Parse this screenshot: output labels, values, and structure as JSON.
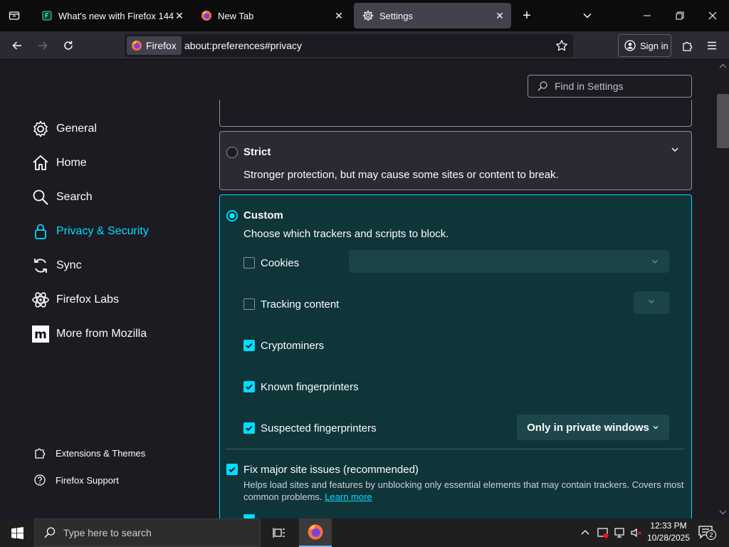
{
  "tabs": [
    {
      "title": "What's new with Firefox 144",
      "icon": "firefox-whatsnew-icon"
    },
    {
      "title": "New Tab",
      "icon": "firefox-logo-icon"
    },
    {
      "title": "Settings",
      "icon": "gear-icon",
      "active": true
    }
  ],
  "navbar": {
    "identity_label": "Firefox",
    "url": "about:preferences#privacy",
    "signin_label": "Sign in"
  },
  "search": {
    "placeholder": "Find in Settings"
  },
  "sidebar": {
    "items": [
      {
        "label": "General",
        "icon": "gear-icon"
      },
      {
        "label": "Home",
        "icon": "home-icon"
      },
      {
        "label": "Search",
        "icon": "search-icon"
      },
      {
        "label": "Privacy & Security",
        "icon": "lock-icon",
        "selected": true
      },
      {
        "label": "Sync",
        "icon": "sync-icon"
      },
      {
        "label": "Firefox Labs",
        "icon": "labs-icon"
      },
      {
        "label": "More from Mozilla",
        "icon": "mozilla-icon"
      }
    ],
    "footer": [
      {
        "label": "Extensions & Themes",
        "icon": "puzzle-icon"
      },
      {
        "label": "Firefox Support",
        "icon": "help-icon"
      }
    ]
  },
  "strict": {
    "title": "Strict",
    "description": "Stronger protection, but may cause some sites or content to break."
  },
  "custom": {
    "title": "Custom",
    "description": "Choose which trackers and scripts to block.",
    "options": [
      {
        "label": "Cookies",
        "checked": false
      },
      {
        "label": "Tracking content",
        "checked": false
      },
      {
        "label": "Cryptominers",
        "checked": true
      },
      {
        "label": "Known fingerprinters",
        "checked": true
      },
      {
        "label": "Suspected fingerprinters",
        "checked": true
      }
    ],
    "fingerprinters_dropdown": "Only in private windows",
    "fix_issues_label": "Fix major site issues (recommended)",
    "fix_issues_checked": true,
    "fix_issues_description": "Helps load sites and features by unblocking only essential elements that may contain trackers. Covers most common problems.",
    "learn_more": "Learn more"
  },
  "taskbar": {
    "search_placeholder": "Type here to search",
    "time": "12:33 PM",
    "date": "10/28/2025",
    "notification_count": "2"
  },
  "colors": {
    "accent": "#00ddff",
    "custom_card_bg": "#0f3539",
    "page_bg": "#1c1b22",
    "toolbar_bg": "#2b2a33"
  }
}
